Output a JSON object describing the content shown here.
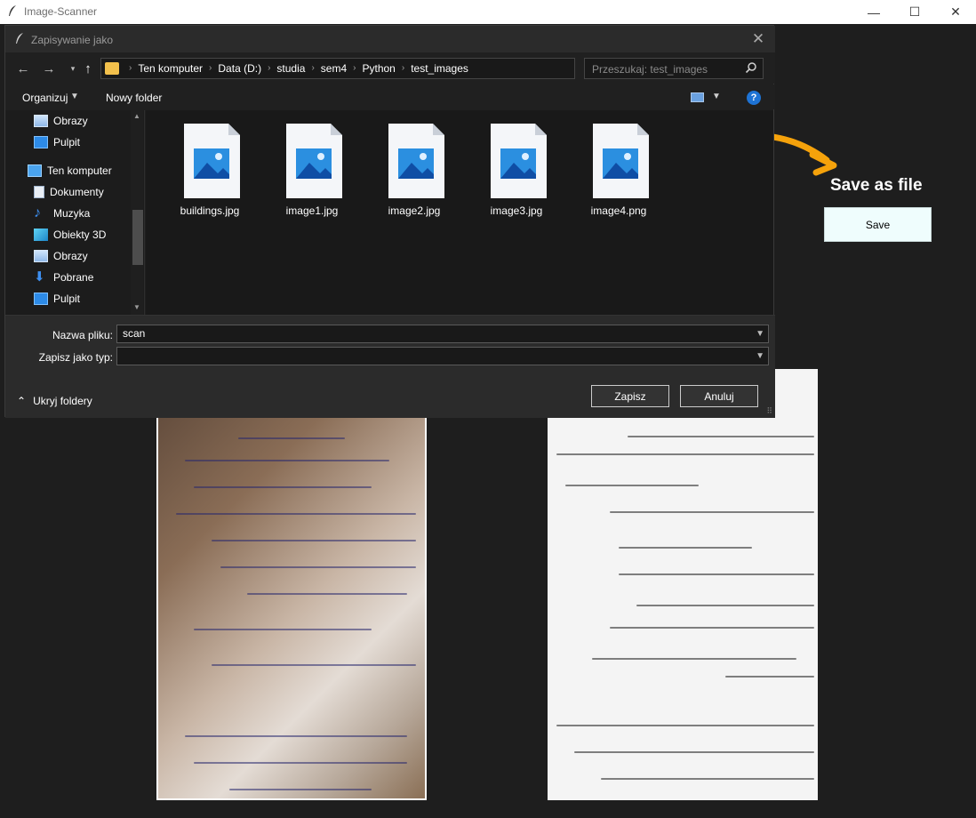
{
  "app": {
    "title": "Image-Scanner",
    "minimize": "—",
    "maximize": "☐",
    "close": "✕"
  },
  "panel": {
    "heading": "Save as file",
    "save_label": "Save",
    "arrow_color": "#f5a20b",
    "button_color": "#effdfd"
  },
  "dialog": {
    "title": "Zapisywanie jako",
    "close": "✕",
    "breadcrumbs": [
      "Ten komputer",
      "Data (D:)",
      "studia",
      "sem4",
      "Python",
      "test_images"
    ],
    "search_placeholder": "Przeszukaj: test_images",
    "toolbar": {
      "organize": "Organizuj",
      "new_folder": "Nowy folder",
      "help": "?"
    },
    "nav_items": [
      {
        "label": "Obrazy",
        "icon": "pictures-icon"
      },
      {
        "label": "Pulpit",
        "icon": "desktop-icon"
      },
      {
        "label": "Ten komputer",
        "icon": "computer-icon"
      },
      {
        "label": "Dokumenty",
        "icon": "documents-icon"
      },
      {
        "label": "Muzyka",
        "icon": "music-icon"
      },
      {
        "label": "Obiekty 3D",
        "icon": "objects-3d-icon"
      },
      {
        "label": "Obrazy",
        "icon": "pictures-icon"
      },
      {
        "label": "Pobrane",
        "icon": "downloads-icon"
      },
      {
        "label": "Pulpit",
        "icon": "desktop-icon"
      }
    ],
    "files": [
      {
        "name": "buildings.jpg"
      },
      {
        "name": "image1.jpg"
      },
      {
        "name": "image2.jpg"
      },
      {
        "name": "image3.jpg"
      },
      {
        "name": "image4.png"
      }
    ],
    "filename_label": "Nazwa pliku:",
    "filename_value": "scan",
    "filetype_label": "Zapisz jako typ:",
    "filetype_value": "",
    "save_button": "Zapisz",
    "cancel_button": "Anuluj",
    "hide_folders": "Ukryj foldery"
  }
}
